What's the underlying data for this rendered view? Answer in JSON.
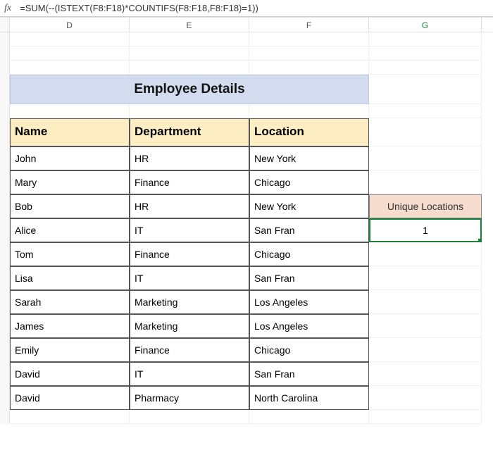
{
  "formula_bar": {
    "fx_label": "fx",
    "formula": "=SUM(--(ISTEXT(F8:F18)*COUNTIFS(F8:F18,F8:F18)=1))"
  },
  "columns": {
    "D": "D",
    "E": "E",
    "F": "F",
    "G": "G"
  },
  "title": "Employee Details",
  "headers": {
    "name": "Name",
    "department": "Department",
    "location": "Location"
  },
  "rows": [
    {
      "name": "John",
      "department": "HR",
      "location": "New York"
    },
    {
      "name": "Mary",
      "department": "Finance",
      "location": "Chicago"
    },
    {
      "name": "Bob",
      "department": "HR",
      "location": "New York"
    },
    {
      "name": "Alice",
      "department": "IT",
      "location": "San Fran"
    },
    {
      "name": "Tom",
      "department": "Finance",
      "location": "Chicago"
    },
    {
      "name": "Lisa",
      "department": "IT",
      "location": "San Fran"
    },
    {
      "name": "Sarah",
      "department": "Marketing",
      "location": "Los Angeles"
    },
    {
      "name": "James",
      "department": "Marketing",
      "location": "Los Angeles"
    },
    {
      "name": "Emily",
      "department": "Finance",
      "location": "Chicago"
    },
    {
      "name": "David",
      "department": "IT",
      "location": "San Fran"
    },
    {
      "name": "David",
      "department": "Pharmacy",
      "location": "North Carolina"
    }
  ],
  "side": {
    "unique_label": "Unique Locations",
    "unique_value": "1"
  },
  "chart_data": {
    "type": "table",
    "title": "Employee Details",
    "columns": [
      "Name",
      "Department",
      "Location"
    ],
    "rows": [
      [
        "John",
        "HR",
        "New York"
      ],
      [
        "Mary",
        "Finance",
        "Chicago"
      ],
      [
        "Bob",
        "HR",
        "New York"
      ],
      [
        "Alice",
        "IT",
        "San Fran"
      ],
      [
        "Tom",
        "Finance",
        "Chicago"
      ],
      [
        "Lisa",
        "IT",
        "San Fran"
      ],
      [
        "Sarah",
        "Marketing",
        "Los Angeles"
      ],
      [
        "James",
        "Marketing",
        "Los Angeles"
      ],
      [
        "Emily",
        "Finance",
        "Chicago"
      ],
      [
        "David",
        "IT",
        "San Fran"
      ],
      [
        "David",
        "Pharmacy",
        "North Carolina"
      ]
    ],
    "unique_locations_result": 1
  }
}
